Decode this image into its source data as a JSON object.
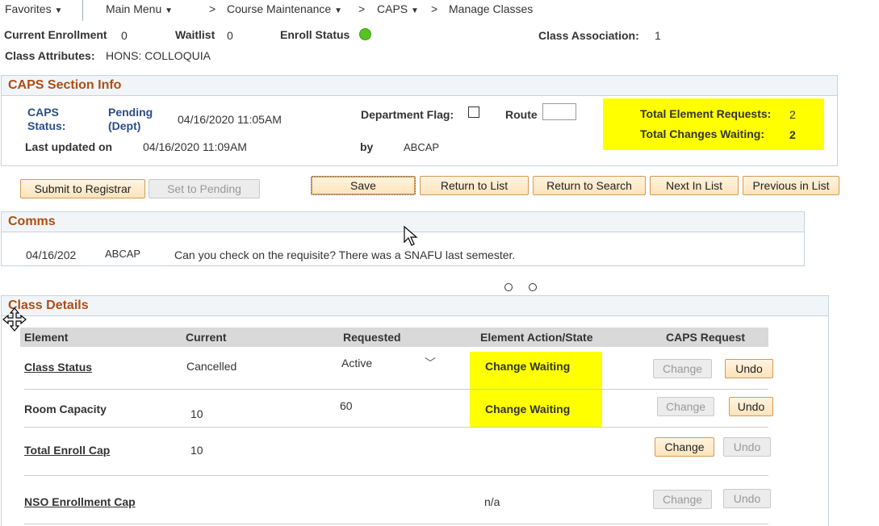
{
  "nav": {
    "favorites": "Favorites",
    "main_menu": "Main Menu",
    "breadcrumbs": [
      "Course Maintenance",
      "CAPS",
      "Manage Classes"
    ],
    "sep": ">"
  },
  "summary": {
    "current_enrollment_label": "Current Enrollment",
    "current_enrollment_value": "0",
    "waitlist_label": "Waitlist",
    "waitlist_value": "0",
    "enroll_status_label": "Enroll Status",
    "class_association_label": "Class Association:",
    "class_association_value": "1",
    "class_attributes_label": "Class Attributes:",
    "class_attributes_value": "HONS: COLLOQUIA"
  },
  "caps_info": {
    "title": "CAPS Section Info",
    "status_label_1": "CAPS",
    "status_label_2": "Status:",
    "status_value_1": "Pending",
    "status_value_2": "(Dept)",
    "status_date": "04/16/2020 11:05AM",
    "dept_flag_label": "Department Flag:",
    "route_label": "Route",
    "last_updated_label": "Last updated on",
    "last_updated_value": "04/16/2020 11:09AM",
    "by_label": "by",
    "by_value": "ABCAP",
    "total_requests_label": "Total Element Requests:",
    "total_requests_value": "2",
    "total_waiting_label": "Total Changes Waiting:",
    "total_waiting_value": "2"
  },
  "buttons": {
    "submit": "Submit to Registrar",
    "set_pending": "Set to Pending",
    "save": "Save",
    "return_list": "Return to List",
    "return_search": "Return to Search",
    "next": "Next In List",
    "previous": "Previous in List"
  },
  "comms": {
    "title": "Comms",
    "date": "04/16/202",
    "user": "ABCAP",
    "message": "Can you check on the requisite? There was a SNAFU last semester."
  },
  "class_details": {
    "title": "Class Details",
    "columns": [
      "Element",
      "Current",
      "Requested",
      "Element Action/State",
      "CAPS Request"
    ],
    "rows": [
      {
        "element": "Class Status",
        "current": "Cancelled",
        "requested": "Active",
        "state": "Change Waiting",
        "change": "Change",
        "undo": "Undo"
      },
      {
        "element": "Room Capacity",
        "current": "10",
        "requested": "60",
        "state": "Change Waiting",
        "change": "Change",
        "undo": "Undo"
      },
      {
        "element": "Total Enroll Cap",
        "current": "10",
        "requested": "",
        "state": "",
        "change": "Change",
        "undo": "Undo"
      },
      {
        "element": "NSO Enrollment Cap",
        "current": "",
        "requested": "",
        "state": "n/a",
        "change": "Change",
        "undo": "Undo"
      }
    ]
  },
  "colors": {
    "highlight": "#ffff00",
    "section_title": "#b04c12",
    "status_green": "#58c322"
  }
}
